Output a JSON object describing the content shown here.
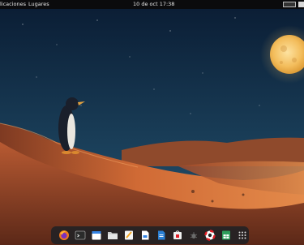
{
  "topbar": {
    "applications_label": "licaciones",
    "places_label": "Lugares",
    "clock": "10 de oct  17:38"
  },
  "dock": {
    "apps": [
      {
        "name": "firefox",
        "icon": "firefox-icon"
      },
      {
        "name": "terminal",
        "icon": "terminal-icon"
      },
      {
        "name": "calendar",
        "icon": "calendar-icon"
      },
      {
        "name": "files",
        "icon": "folder-icon"
      },
      {
        "name": "text-editor",
        "icon": "text-editor-icon"
      },
      {
        "name": "document",
        "icon": "document-icon"
      },
      {
        "name": "writer",
        "icon": "writer-icon"
      },
      {
        "name": "software",
        "icon": "software-icon"
      },
      {
        "name": "bug",
        "icon": "bug-icon"
      },
      {
        "name": "help",
        "icon": "lifebuoy-icon"
      },
      {
        "name": "calc",
        "icon": "spreadsheet-icon"
      },
      {
        "name": "app-grid",
        "icon": "app-grid-icon"
      }
    ]
  },
  "colors": {
    "sky_top": "#0a1c33",
    "sky_mid": "#1b3a55",
    "moon": "#f2c56a",
    "dune_light": "#e8894a",
    "dune_dark": "#6a2e1c"
  }
}
